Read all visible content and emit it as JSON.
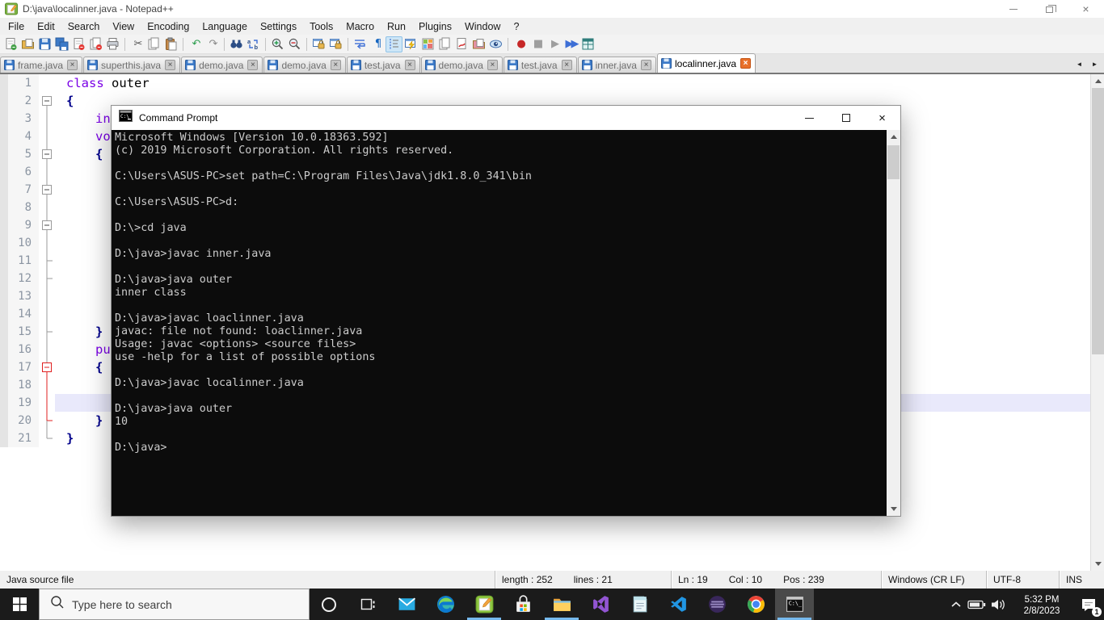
{
  "titlebar": {
    "title": "D:\\java\\localinner.java - Notepad++"
  },
  "glyphs": {
    "close": "×",
    "scroll_left": "◄",
    "scroll_right": "►"
  },
  "menu": [
    "File",
    "Edit",
    "Search",
    "View",
    "Encoding",
    "Language",
    "Settings",
    "Tools",
    "Macro",
    "Run",
    "Plugins",
    "Window",
    "?"
  ],
  "toolbar": [
    {
      "name": "new-file-icon",
      "kind": "page",
      "badge": "#43A047"
    },
    {
      "name": "open-folder-icon",
      "kind": "folder",
      "color": "#E8B64C"
    },
    {
      "name": "save-icon",
      "kind": "floppy"
    },
    {
      "name": "save-all-icon",
      "kind": "floppy2"
    },
    {
      "name": "close-icon",
      "kind": "page",
      "badge": "#E53935"
    },
    {
      "name": "close-all-icon",
      "kind": "page2",
      "badge": "#E53935"
    },
    {
      "name": "print-icon",
      "kind": "printer"
    },
    {
      "name": "separator",
      "kind": "sep"
    },
    {
      "name": "cut-icon",
      "kind": "glyph",
      "glyph": "✂",
      "color": "#555555"
    },
    {
      "name": "copy-icon",
      "kind": "page2",
      "badge": ""
    },
    {
      "name": "paste-icon",
      "kind": "paste"
    },
    {
      "name": "separator",
      "kind": "sep"
    },
    {
      "name": "undo-icon",
      "kind": "glyph",
      "glyph": "↶",
      "color": "#2E9E4F"
    },
    {
      "name": "redo-icon",
      "kind": "glyph",
      "glyph": "↷",
      "color": "#8A8A8A"
    },
    {
      "name": "separator",
      "kind": "sep"
    },
    {
      "name": "find-icon",
      "kind": "binoculars"
    },
    {
      "name": "replace-icon",
      "kind": "replace"
    },
    {
      "name": "separator",
      "kind": "sep"
    },
    {
      "name": "zoom-in-icon",
      "kind": "magnifier",
      "color": "#2E9E4F"
    },
    {
      "name": "zoom-out-icon",
      "kind": "magnifier",
      "color": "#D33B3B"
    },
    {
      "name": "separator",
      "kind": "sep"
    },
    {
      "name": "sync-vertical-icon",
      "kind": "winlock"
    },
    {
      "name": "sync-horizontal-icon",
      "kind": "winlock"
    },
    {
      "name": "separator",
      "kind": "sep"
    },
    {
      "name": "word-wrap-icon",
      "kind": "wrap"
    },
    {
      "name": "show-all-chars-icon",
      "kind": "glyph",
      "glyph": "¶",
      "color": "#1565C0"
    },
    {
      "name": "indent-guide-icon",
      "kind": "indent",
      "active": true
    },
    {
      "name": "function-list-icon",
      "kind": "bolt"
    },
    {
      "name": "doc-map-icon",
      "kind": "map"
    },
    {
      "name": "doc-list-icon",
      "kind": "page2",
      "badge": ""
    },
    {
      "name": "doc-monitor-icon",
      "kind": "script"
    },
    {
      "name": "folder-workspace-icon",
      "kind": "folder",
      "color": "#E591A2"
    },
    {
      "name": "view-eye-icon",
      "kind": "eye"
    },
    {
      "name": "separator",
      "kind": "sep"
    },
    {
      "name": "macro-record-icon",
      "kind": "glyph",
      "glyph": "●",
      "color": "#C62828"
    },
    {
      "name": "macro-stop-icon",
      "kind": "glyph",
      "glyph": "■",
      "color": "#9E9E9E"
    },
    {
      "name": "macro-play-icon",
      "kind": "glyph",
      "glyph": "▶",
      "color": "#9E9E9E"
    },
    {
      "name": "macro-run-multiple-icon",
      "kind": "glyph",
      "glyph": "▶▶",
      "color": "#3D6FD6"
    },
    {
      "name": "macro-save-icon",
      "kind": "grid"
    }
  ],
  "tabs": [
    {
      "label": "frame.java",
      "active": false
    },
    {
      "label": "superthis.java",
      "active": false
    },
    {
      "label": "demo.java",
      "active": false
    },
    {
      "label": "demo.java",
      "active": false
    },
    {
      "label": "test.java",
      "active": false
    },
    {
      "label": "demo.java",
      "active": false
    },
    {
      "label": "test.java",
      "active": false
    },
    {
      "label": "inner.java",
      "active": false
    },
    {
      "label": "localinner.java",
      "active": true
    }
  ],
  "editor": {
    "colors": {
      "keyword": "#7A00E6",
      "brace": "#00008B",
      "current_line": "#E9E9FB"
    },
    "rows": [
      {
        "n": "1",
        "fold": "none",
        "indent": 0,
        "segments": [
          [
            "kw",
            "class"
          ],
          [
            "plain",
            " outer"
          ]
        ]
      },
      {
        "n": "2",
        "fold": "open-top",
        "indent": 0,
        "segments": [
          [
            "brace",
            "{"
          ]
        ]
      },
      {
        "n": "3",
        "fold": "line",
        "indent": 1,
        "segments": [
          [
            "kw",
            "in"
          ]
        ]
      },
      {
        "n": "4",
        "fold": "line",
        "indent": 1,
        "segments": [
          [
            "kw",
            "vo"
          ]
        ]
      },
      {
        "n": "5",
        "fold": "open",
        "indent": 1,
        "segments": [
          [
            "brace",
            "{"
          ]
        ]
      },
      {
        "n": "6",
        "fold": "line",
        "indent": 1,
        "segments": [],
        "guide": true
      },
      {
        "n": "7",
        "fold": "open",
        "indent": 1,
        "segments": []
      },
      {
        "n": "8",
        "fold": "line",
        "indent": 1,
        "segments": [],
        "guide": true
      },
      {
        "n": "9",
        "fold": "open",
        "indent": 1,
        "segments": []
      },
      {
        "n": "10",
        "fold": "line",
        "indent": 1,
        "segments": [],
        "guide": true
      },
      {
        "n": "11",
        "fold": "tick",
        "indent": 1,
        "segments": [],
        "guide": true
      },
      {
        "n": "12",
        "fold": "tick",
        "indent": 1,
        "segments": [],
        "guide": true
      },
      {
        "n": "13",
        "fold": "line",
        "indent": 1,
        "segments": [],
        "guide": true
      },
      {
        "n": "14",
        "fold": "line",
        "indent": 1,
        "segments": [],
        "guide": true
      },
      {
        "n": "15",
        "fold": "tick",
        "indent": 1,
        "segments": [
          [
            "brace",
            "}"
          ]
        ]
      },
      {
        "n": "16",
        "fold": "line",
        "indent": 1,
        "segments": [
          [
            "kw",
            "pu"
          ]
        ]
      },
      {
        "n": "17",
        "fold": "open-red",
        "indent": 1,
        "segments": [
          [
            "brace",
            "{"
          ]
        ]
      },
      {
        "n": "18",
        "fold": "line-red",
        "indent": 1,
        "segments": [],
        "guide": true
      },
      {
        "n": "19",
        "fold": "line-red",
        "indent": 1,
        "segments": [],
        "guide": true,
        "current": true
      },
      {
        "n": "20",
        "fold": "tick-red",
        "indent": 1,
        "segments": [
          [
            "brace",
            "}"
          ]
        ]
      },
      {
        "n": "21",
        "fold": "end",
        "indent": 0,
        "segments": [
          [
            "brace",
            "}"
          ]
        ]
      }
    ]
  },
  "cmd": {
    "title": "Command Prompt",
    "lines": [
      "Microsoft Windows [Version 10.0.18363.592]",
      "(c) 2019 Microsoft Corporation. All rights reserved.",
      "",
      "C:\\Users\\ASUS-PC>set path=C:\\Program Files\\Java\\jdk1.8.0_341\\bin",
      "",
      "C:\\Users\\ASUS-PC>d:",
      "",
      "D:\\>cd java",
      "",
      "D:\\java>javac inner.java",
      "",
      "D:\\java>java outer",
      "inner class",
      "",
      "D:\\java>javac loaclinner.java",
      "javac: file not found: loaclinner.java",
      "Usage: javac <options> <source files>",
      "use -help for a list of possible options",
      "",
      "D:\\java>javac localinner.java",
      "",
      "D:\\java>java outer",
      "10",
      "",
      "D:\\java>"
    ]
  },
  "statusbar": {
    "doc_type": "Java source file",
    "length": "length : 252",
    "lines": "lines : 21",
    "ln": "Ln : 19",
    "col": "Col : 10",
    "pos": "Pos : 239",
    "eol": "Windows (CR LF)",
    "encoding": "UTF-8",
    "mode": "INS"
  },
  "taskbar": {
    "search_placeholder": "Type here to search",
    "apps": [
      {
        "name": "mail",
        "running": false,
        "focused": false
      },
      {
        "name": "edge",
        "running": false,
        "focused": false
      },
      {
        "name": "notepad-plus-plus",
        "running": true,
        "focused": false
      },
      {
        "name": "microsoft-store",
        "running": false,
        "focused": false
      },
      {
        "name": "file-explorer",
        "running": true,
        "focused": false
      },
      {
        "name": "visual-studio",
        "running": false,
        "focused": false
      },
      {
        "name": "notepad",
        "running": false,
        "focused": false
      },
      {
        "name": "vscode",
        "running": false,
        "focused": false
      },
      {
        "name": "eclipse",
        "running": false,
        "focused": false
      },
      {
        "name": "chrome",
        "running": false,
        "focused": false
      },
      {
        "name": "cmd",
        "running": true,
        "focused": true
      }
    ],
    "tray": {
      "time": "5:32 PM",
      "date": "2/8/2023",
      "badge": "1"
    }
  }
}
